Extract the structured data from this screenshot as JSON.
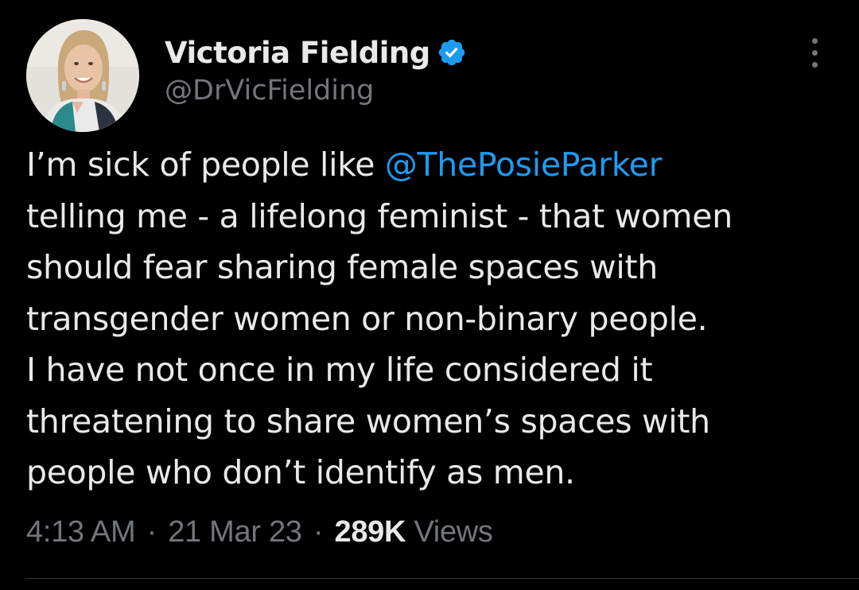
{
  "author": {
    "display_name": "Victoria Fielding",
    "handle": "@DrVicFielding",
    "verified": true
  },
  "tweet": {
    "lines": [
      {
        "before": "I’m sick of people like ",
        "mention": "@ThePosieParker"
      },
      {
        "text": "telling me - a lifelong feminist - that women"
      },
      {
        "text": "should fear sharing female spaces with"
      },
      {
        "text": "transgender women or non-binary people."
      },
      {
        "text": "I have not once in my life considered it"
      },
      {
        "text": "threatening to share women’s spaces with"
      },
      {
        "text": "people who don’t identify as men."
      }
    ]
  },
  "meta": {
    "time": "4:13 AM",
    "date": "21 Mar 23",
    "views_count": "289K",
    "views_label": "Views",
    "separator": "·"
  },
  "icons": {
    "verified": "verified-badge-icon",
    "more": "more-options-icon"
  },
  "colors": {
    "background": "#000000",
    "text": "#e7e9ea",
    "secondary": "#71767b",
    "accent": "#1d9bf0"
  }
}
